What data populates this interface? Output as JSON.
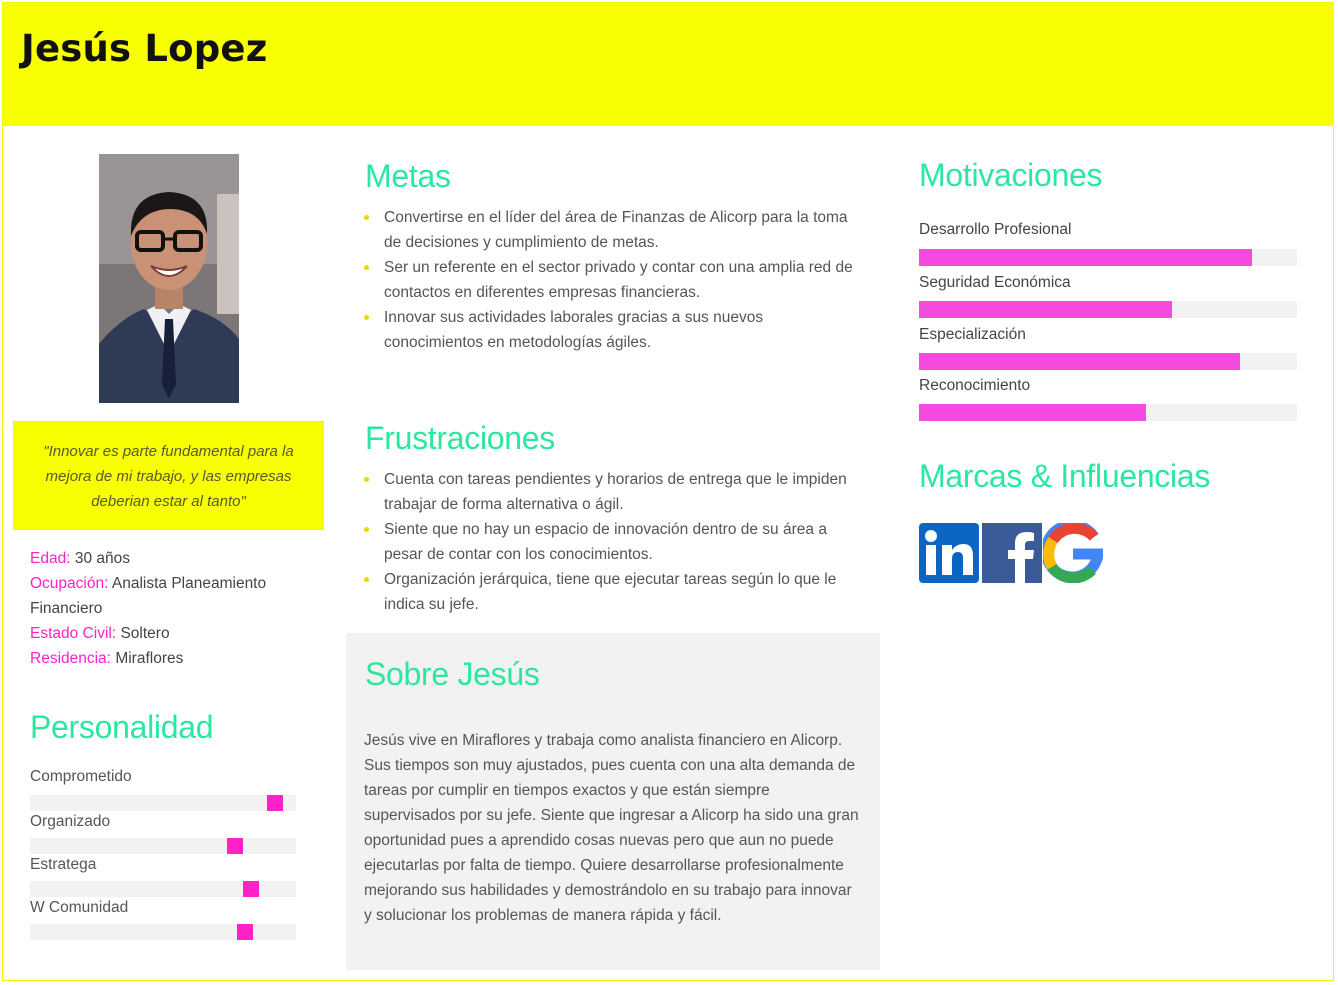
{
  "persona": {
    "name": "Jesús Lopez",
    "quote": "\"Innovar es parte fundamental para la mejora de mi trabajo, y las empresas deberian estar al tanto\"",
    "facts": [
      {
        "label": "Edad:",
        "value": "30 años"
      },
      {
        "label": "Ocupación:",
        "value": "Analista Planeamiento Financiero"
      },
      {
        "label": "Estado Civil:",
        "value": "Soltero"
      },
      {
        "label": "Residencia:",
        "value": "Miraflores"
      }
    ]
  },
  "personality": {
    "title": "Personalidad",
    "traits": [
      {
        "name": "Comprometido",
        "level": 0.92
      },
      {
        "name": "Organizado",
        "level": 0.77
      },
      {
        "name": "Estratega",
        "level": 0.83
      },
      {
        "name": "W Comunidad",
        "level": 0.81
      }
    ]
  },
  "goals": {
    "title": "Metas",
    "items": [
      "Convertirse en el líder del área de Finanzas de Alicorp para la toma de decisiones y cumplimiento de metas.",
      "Ser un referente en el sector privado y contar con una amplia red de contactos en diferentes empresas financieras.",
      "Innovar sus actividades laborales gracias a sus nuevos conocimientos en metodologías ágiles."
    ]
  },
  "frustrations": {
    "title": "Frustraciones",
    "items": [
      "Cuenta con tareas pendientes y horarios de entrega que le impiden trabajar de forma alternativa o ágil.",
      "Siente que no hay un espacio de innovación dentro de su área a pesar de contar con los conocimientos.",
      "Organización jerárquica, tiene que ejecutar tareas según lo que le indica su jefe."
    ]
  },
  "about": {
    "title": "Sobre Jesús",
    "text": "Jesús vive en Miraflores y trabaja como analista financiero en Alicorp. Sus tiempos son muy ajustados, pues cuenta con una alta demanda de tareas por cumplir en tiempos exactos y que están siempre supervisados por su jefe. Siente que ingresar a Alicorp ha sido una gran oportunidad pues a aprendido cosas nuevas pero que aun no puede ejecutarlas por falta de tiempo. Quiere desarrollarse profesionalmente mejorando sus habilidades y demostrándolo en su trabajo para innovar y solucionar los problemas de manera rápida y fácil."
  },
  "motivations": {
    "title": "Motivaciones",
    "items": [
      {
        "name": "Desarrollo Profesional",
        "level": 0.88
      },
      {
        "name": "Seguridad Económica",
        "level": 0.67
      },
      {
        "name": "Especialización",
        "level": 0.85
      },
      {
        "name": "Reconocimiento",
        "level": 0.6
      }
    ]
  },
  "brands": {
    "title": "Marcas & Influencias",
    "logos": [
      "linkedin-logo",
      "facebook-logo",
      "google-logo"
    ]
  },
  "colors": {
    "header": "#f8ff00",
    "title_green": "#2be8a0",
    "accent_pink": "#ff22c8",
    "bar_pink": "#f54ae0"
  }
}
